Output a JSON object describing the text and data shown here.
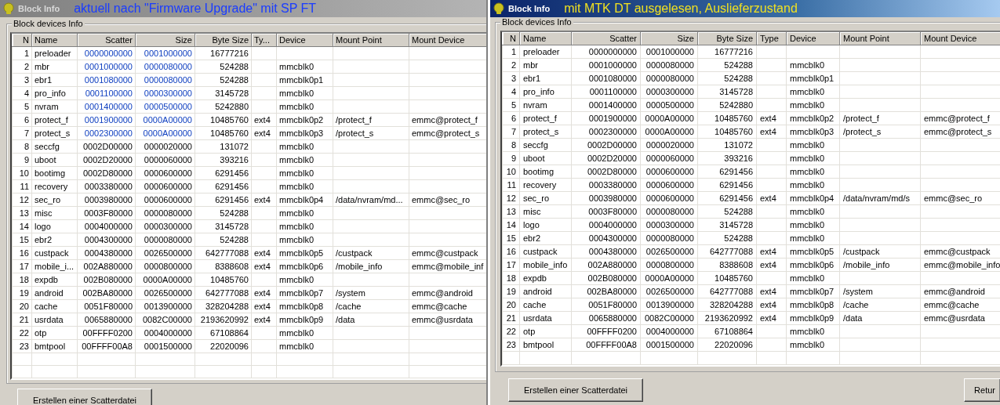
{
  "windows": [
    {
      "title": "Block Info",
      "annotation": "aktuell nach \"Firmware Upgrade\" mit SP FT",
      "active": false,
      "group_label": "Block devices Info",
      "columns": [
        "N",
        "Name",
        "Scatter",
        "Size",
        "Byte Size",
        "Ty...",
        "Device",
        "Mount Point",
        "Mount Device"
      ],
      "rows": [
        {
          "n": "1",
          "name": "preloader",
          "scatter": "0000000000",
          "size": "0001000000",
          "byte_size": "16777216",
          "highlighted": true
        },
        {
          "n": "2",
          "name": "mbr",
          "scatter": "0001000000",
          "size": "0000080000",
          "byte_size": "524288",
          "device": "mmcblk0",
          "highlighted": true
        },
        {
          "n": "3",
          "name": "ebr1",
          "scatter": "0001080000",
          "size": "0000080000",
          "byte_size": "524288",
          "device": "mmcblk0p1",
          "highlighted": true
        },
        {
          "n": "4",
          "name": "pro_info",
          "scatter": "0001100000",
          "size": "0000300000",
          "byte_size": "3145728",
          "device": "mmcblk0",
          "highlighted": true
        },
        {
          "n": "5",
          "name": "nvram",
          "scatter": "0001400000",
          "size": "0000500000",
          "byte_size": "5242880",
          "device": "mmcblk0",
          "highlighted": true
        },
        {
          "n": "6",
          "name": "protect_f",
          "scatter": "0001900000",
          "size": "0000A00000",
          "byte_size": "10485760",
          "type": "ext4",
          "device": "mmcblk0p2",
          "mount_point": "/protect_f",
          "mount_device": "emmc@protect_f",
          "highlighted": true
        },
        {
          "n": "7",
          "name": "protect_s",
          "scatter": "0002300000",
          "size": "0000A00000",
          "byte_size": "10485760",
          "type": "ext4",
          "device": "mmcblk0p3",
          "mount_point": "/protect_s",
          "mount_device": "emmc@protect_s",
          "highlighted": true
        },
        {
          "n": "8",
          "name": "seccfg",
          "scatter": "0002D00000",
          "size": "0000020000",
          "byte_size": "131072",
          "device": "mmcblk0",
          "highlighted": false
        },
        {
          "n": "9",
          "name": "uboot",
          "scatter": "0002D20000",
          "size": "0000060000",
          "byte_size": "393216",
          "device": "mmcblk0",
          "highlighted": false
        },
        {
          "n": "10",
          "name": "bootimg",
          "scatter": "0002D80000",
          "size": "0000600000",
          "byte_size": "6291456",
          "device": "mmcblk0",
          "highlighted": false
        },
        {
          "n": "11",
          "name": "recovery",
          "scatter": "0003380000",
          "size": "0000600000",
          "byte_size": "6291456",
          "device": "mmcblk0",
          "highlighted": false
        },
        {
          "n": "12",
          "name": "sec_ro",
          "scatter": "0003980000",
          "size": "0000600000",
          "byte_size": "6291456",
          "type": "ext4",
          "device": "mmcblk0p4",
          "mount_point": "/data/nvram/md...",
          "mount_device": "emmc@sec_ro",
          "highlighted": false
        },
        {
          "n": "13",
          "name": "misc",
          "scatter": "0003F80000",
          "size": "0000080000",
          "byte_size": "524288",
          "device": "mmcblk0",
          "highlighted": false
        },
        {
          "n": "14",
          "name": "logo",
          "scatter": "0004000000",
          "size": "0000300000",
          "byte_size": "3145728",
          "device": "mmcblk0",
          "highlighted": false
        },
        {
          "n": "15",
          "name": "ebr2",
          "scatter": "0004300000",
          "size": "0000080000",
          "byte_size": "524288",
          "device": "mmcblk0",
          "highlighted": false
        },
        {
          "n": "16",
          "name": "custpack",
          "scatter": "0004380000",
          "size": "0026500000",
          "byte_size": "642777088",
          "type": "ext4",
          "device": "mmcblk0p5",
          "mount_point": "/custpack",
          "mount_device": "emmc@custpack",
          "highlighted": false
        },
        {
          "n": "17",
          "name": "mobile_i...",
          "scatter": "002A880000",
          "size": "0000800000",
          "byte_size": "8388608",
          "type": "ext4",
          "device": "mmcblk0p6",
          "mount_point": "/mobile_info",
          "mount_device": "emmc@mobile_inf",
          "highlighted": false
        },
        {
          "n": "18",
          "name": "expdb",
          "scatter": "002B080000",
          "size": "0000A00000",
          "byte_size": "10485760",
          "device": "mmcblk0",
          "highlighted": false
        },
        {
          "n": "19",
          "name": "android",
          "scatter": "002BA80000",
          "size": "0026500000",
          "byte_size": "642777088",
          "type": "ext4",
          "device": "mmcblk0p7",
          "mount_point": "/system",
          "mount_device": "emmc@android",
          "highlighted": false
        },
        {
          "n": "20",
          "name": "cache",
          "scatter": "0051F80000",
          "size": "0013900000",
          "byte_size": "328204288",
          "type": "ext4",
          "device": "mmcblk0p8",
          "mount_point": "/cache",
          "mount_device": "emmc@cache",
          "highlighted": false
        },
        {
          "n": "21",
          "name": "usrdata",
          "scatter": "0065880000",
          "size": "0082C00000",
          "byte_size": "2193620992",
          "type": "ext4",
          "device": "mmcblk0p9",
          "mount_point": "/data",
          "mount_device": "emmc@usrdata",
          "highlighted": false
        },
        {
          "n": "22",
          "name": "otp",
          "scatter": "00FFFF0200",
          "size": "0004000000",
          "byte_size": "67108864",
          "device": "mmcblk0",
          "highlighted": false
        },
        {
          "n": "23",
          "name": "bmtpool",
          "scatter": "00FFFF00A8",
          "size": "0001500000",
          "byte_size": "22020096",
          "device": "mmcblk0",
          "highlighted": false
        }
      ],
      "buttons": [
        "Erstellen einer Scatterdatei"
      ]
    },
    {
      "title": "Block Info",
      "annotation": "mit MTK DT ausgelesen, Auslieferzustand",
      "active": true,
      "group_label": "Block devices Info",
      "columns": [
        "N",
        "Name",
        "Scatter",
        "Size",
        "Byte Size",
        "Type",
        "Device",
        "Mount Point",
        "Mount Device"
      ],
      "rows": [
        {
          "n": "1",
          "name": "preloader",
          "scatter": "0000000000",
          "size": "0001000000",
          "byte_size": "16777216",
          "highlighted": false
        },
        {
          "n": "2",
          "name": "mbr",
          "scatter": "0001000000",
          "size": "0000080000",
          "byte_size": "524288",
          "device": "mmcblk0",
          "highlighted": false
        },
        {
          "n": "3",
          "name": "ebr1",
          "scatter": "0001080000",
          "size": "0000080000",
          "byte_size": "524288",
          "device": "mmcblk0p1",
          "highlighted": false
        },
        {
          "n": "4",
          "name": "pro_info",
          "scatter": "0001100000",
          "size": "0000300000",
          "byte_size": "3145728",
          "device": "mmcblk0",
          "highlighted": false
        },
        {
          "n": "5",
          "name": "nvram",
          "scatter": "0001400000",
          "size": "0000500000",
          "byte_size": "5242880",
          "device": "mmcblk0",
          "highlighted": false
        },
        {
          "n": "6",
          "name": "protect_f",
          "scatter": "0001900000",
          "size": "0000A00000",
          "byte_size": "10485760",
          "type": "ext4",
          "device": "mmcblk0p2",
          "mount_point": "/protect_f",
          "mount_device": "emmc@protect_f",
          "highlighted": false
        },
        {
          "n": "7",
          "name": "protect_s",
          "scatter": "0002300000",
          "size": "0000A00000",
          "byte_size": "10485760",
          "type": "ext4",
          "device": "mmcblk0p3",
          "mount_point": "/protect_s",
          "mount_device": "emmc@protect_s",
          "highlighted": false
        },
        {
          "n": "8",
          "name": "seccfg",
          "scatter": "0002D00000",
          "size": "0000020000",
          "byte_size": "131072",
          "device": "mmcblk0",
          "highlighted": false
        },
        {
          "n": "9",
          "name": "uboot",
          "scatter": "0002D20000",
          "size": "0000060000",
          "byte_size": "393216",
          "device": "mmcblk0",
          "highlighted": false
        },
        {
          "n": "10",
          "name": "bootimg",
          "scatter": "0002D80000",
          "size": "0000600000",
          "byte_size": "6291456",
          "device": "mmcblk0",
          "highlighted": false
        },
        {
          "n": "11",
          "name": "recovery",
          "scatter": "0003380000",
          "size": "0000600000",
          "byte_size": "6291456",
          "device": "mmcblk0",
          "highlighted": false
        },
        {
          "n": "12",
          "name": "sec_ro",
          "scatter": "0003980000",
          "size": "0000600000",
          "byte_size": "6291456",
          "type": "ext4",
          "device": "mmcblk0p4",
          "mount_point": "/data/nvram/md/s",
          "mount_device": "emmc@sec_ro",
          "highlighted": false
        },
        {
          "n": "13",
          "name": "misc",
          "scatter": "0003F80000",
          "size": "0000080000",
          "byte_size": "524288",
          "device": "mmcblk0",
          "highlighted": false
        },
        {
          "n": "14",
          "name": "logo",
          "scatter": "0004000000",
          "size": "0000300000",
          "byte_size": "3145728",
          "device": "mmcblk0",
          "highlighted": false
        },
        {
          "n": "15",
          "name": "ebr2",
          "scatter": "0004300000",
          "size": "0000080000",
          "byte_size": "524288",
          "device": "mmcblk0",
          "highlighted": false
        },
        {
          "n": "16",
          "name": "custpack",
          "scatter": "0004380000",
          "size": "0026500000",
          "byte_size": "642777088",
          "type": "ext4",
          "device": "mmcblk0p5",
          "mount_point": "/custpack",
          "mount_device": "emmc@custpack",
          "highlighted": false
        },
        {
          "n": "17",
          "name": "mobile_info",
          "scatter": "002A880000",
          "size": "0000800000",
          "byte_size": "8388608",
          "type": "ext4",
          "device": "mmcblk0p6",
          "mount_point": "/mobile_info",
          "mount_device": "emmc@mobile_info",
          "highlighted": false
        },
        {
          "n": "18",
          "name": "expdb",
          "scatter": "002B080000",
          "size": "0000A00000",
          "byte_size": "10485760",
          "device": "mmcblk0",
          "highlighted": false
        },
        {
          "n": "19",
          "name": "android",
          "scatter": "002BA80000",
          "size": "0026500000",
          "byte_size": "642777088",
          "type": "ext4",
          "device": "mmcblk0p7",
          "mount_point": "/system",
          "mount_device": "emmc@android",
          "highlighted": false
        },
        {
          "n": "20",
          "name": "cache",
          "scatter": "0051F80000",
          "size": "0013900000",
          "byte_size": "328204288",
          "type": "ext4",
          "device": "mmcblk0p8",
          "mount_point": "/cache",
          "mount_device": "emmc@cache",
          "highlighted": false
        },
        {
          "n": "21",
          "name": "usrdata",
          "scatter": "0065880000",
          "size": "0082C00000",
          "byte_size": "2193620992",
          "type": "ext4",
          "device": "mmcblk0p9",
          "mount_point": "/data",
          "mount_device": "emmc@usrdata",
          "highlighted": false
        },
        {
          "n": "22",
          "name": "otp",
          "scatter": "00FFFF0200",
          "size": "0004000000",
          "byte_size": "67108864",
          "device": "mmcblk0",
          "highlighted": false
        },
        {
          "n": "23",
          "name": "bmtpool",
          "scatter": "00FFFF00A8",
          "size": "0001500000",
          "byte_size": "22020096",
          "device": "mmcblk0",
          "highlighted": false
        }
      ],
      "buttons": [
        "Erstellen einer Scatterdatei",
        "Retur"
      ]
    }
  ]
}
